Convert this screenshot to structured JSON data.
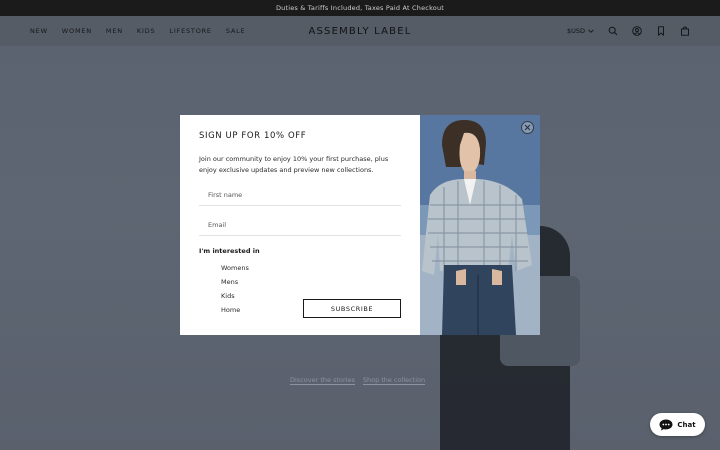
{
  "announcement": {
    "text": "Duties & Tariffs Included, Taxes Paid At Checkout"
  },
  "header": {
    "nav": [
      "NEW",
      "WOMEN",
      "MEN",
      "KIDS",
      "LIFESTORE",
      "SALE"
    ],
    "logo": "ASSEMBLY LABEL",
    "currency": "$USD",
    "icons": [
      "search-icon",
      "account-icon",
      "wishlist-icon",
      "cart-icon"
    ]
  },
  "hero": {
    "links": [
      "Discover the stories",
      "Shop the collection"
    ]
  },
  "modal": {
    "title": "SIGN UP FOR 10% OFF",
    "description": "Join our community to enjoy 10% your first purchase, plus enjoy exclusive updates and preview new collections.",
    "first_name_placeholder": "First name",
    "email_placeholder": "Email",
    "interest_label": "I'm interested in",
    "interests": [
      "Womens",
      "Mens",
      "Kids",
      "Home"
    ],
    "subscribe_label": "SUBSCRIBE",
    "close_icon": "close-icon"
  },
  "chat": {
    "label": "Chat",
    "icon": "chat-bubble-icon"
  },
  "colors": {
    "announcement_bg": "#1b1b1b",
    "overlay": "#5d6572",
    "modal_bg": "#ffffff",
    "text": "#1a1a1a"
  }
}
